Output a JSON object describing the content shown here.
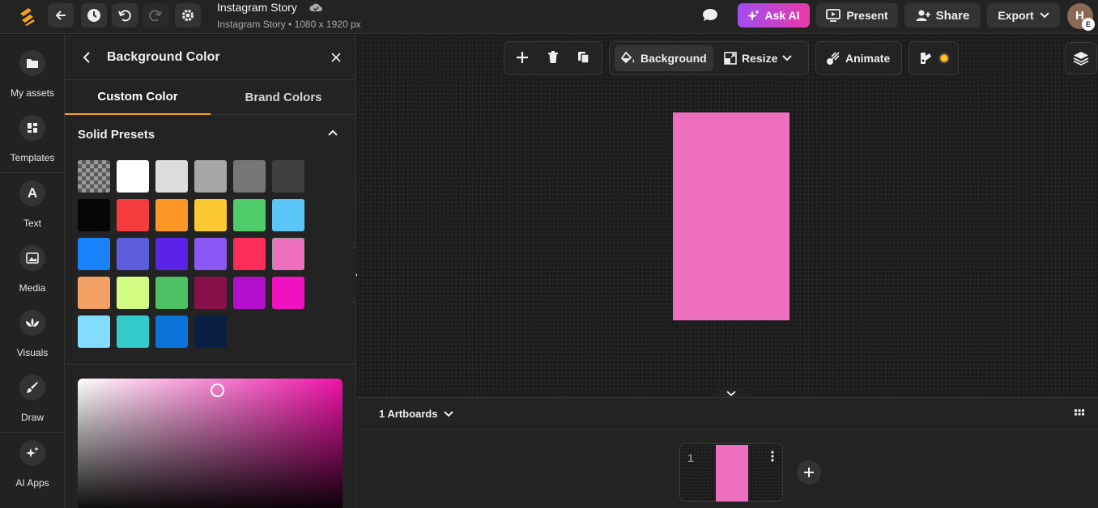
{
  "header": {
    "title": "Instagram Story",
    "subtitle": "Instagram Story • 1080 x 1920 px",
    "ask_ai": "Ask AI",
    "present": "Present",
    "share": "Share",
    "export": "Export",
    "avatar_badge": "E",
    "avatar_letter": "H"
  },
  "rail": {
    "items": [
      {
        "label": "My assets",
        "icon": "folder-icon"
      },
      {
        "label": "Templates",
        "icon": "templates-icon"
      },
      {
        "label": "Text",
        "icon": "text-icon"
      },
      {
        "label": "Media",
        "icon": "image-icon"
      },
      {
        "label": "Visuals",
        "icon": "visuals-icon"
      },
      {
        "label": "Draw",
        "icon": "brush-icon"
      },
      {
        "label": "AI Apps",
        "icon": "sparkle-icon"
      }
    ]
  },
  "panel": {
    "title": "Background Color",
    "tabs": [
      "Custom Color",
      "Brand Colors"
    ],
    "active_tab": "Custom Color",
    "section_title": "Solid Presets",
    "swatches": [
      "transparent",
      "#ffffff",
      "#dddddd",
      "#a6a6a6",
      "#777777",
      "#3f3f3f",
      "#060606",
      "#f43c3c",
      "#fd9728",
      "#fdc932",
      "#4fcb6a",
      "#5ac6f8",
      "#1982fb",
      "#5b5ddb",
      "#5a23e7",
      "#8c56f5",
      "#fc2e59",
      "#ee6ec0",
      "#f3a065",
      "#d3fc82",
      "#4cc062",
      "#881049",
      "#b20ecb",
      "#f011c0",
      "#82dcfd",
      "#33cbca",
      "#0a73d9",
      "#0a1f44"
    ],
    "selected_swatch": "#ee6ec0",
    "picker_hue": "#f011a8"
  },
  "toolbar": {
    "background": "Background",
    "resize": "Resize",
    "animate": "Animate"
  },
  "artboard": {
    "color": "#ee6ec0"
  },
  "strip": {
    "title": "1 Artboards",
    "thumb_number": "1"
  }
}
